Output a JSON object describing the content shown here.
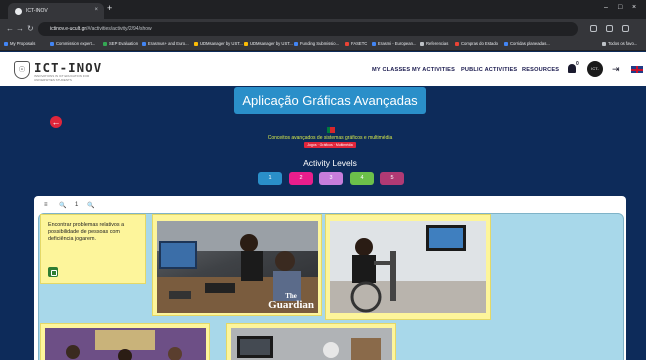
{
  "browser": {
    "tab_title": "ICT-INOV",
    "new_tab": "+",
    "window_controls": [
      "–",
      "□",
      "×"
    ],
    "nav": [
      "←",
      "→",
      "↻"
    ],
    "url_host": "ictinov.e-ucult.gr",
    "url_path": "/#/activities/activity/2/94/show",
    "bookmarks": [
      "My Proposals",
      "Commission expert...",
      "SEP Evaluation",
      "Erasmus+ and Euro...",
      "UDMsanager by UST...",
      "UDMsanager by UST...",
      "Funding Submissio...",
      "FASETC",
      "Erasmi - European...",
      "Referencias",
      "Compras do Estado",
      "Corridas planeadas..."
    ],
    "all_bookmarks": "Todos os favo..."
  },
  "site": {
    "logo_text": "ICT-INOV",
    "logo_sub": "INNOVATIONS IN ICT EDUCATION FOR UNIVERSITIES STUDENTS",
    "nav": {
      "classes": "MY CLASSES",
      "activities": "MY ACTIVITIES",
      "public": "PUBLIC ACTIVITIES",
      "resources": "RESOURCES"
    },
    "notifications": "0",
    "avatar_label": "ICT-INOV",
    "logout_icon": "⇥"
  },
  "page": {
    "title": "Aplicação Gráficas Avançadas",
    "back_icon": "←",
    "subtitle": "Conceitos avançados de sistemas gráficos e multimédia",
    "tags": "Jogos · Gráficos · Multimédia",
    "activity_levels_title": "Activity Levels",
    "levels": [
      {
        "label": "1",
        "color": "#2a8fc9"
      },
      {
        "label": "2",
        "color": "#e91e8c"
      },
      {
        "label": "3",
        "color": "#c77ddb"
      },
      {
        "label": "4",
        "color": "#6cc04a"
      },
      {
        "label": "5",
        "color": "#b03a74"
      }
    ]
  },
  "board": {
    "toolbar": [
      "≡",
      "🔍",
      "1",
      "🔍"
    ],
    "card_text": "Encontrar problemas relativos a possibilidade de pessoas com deficiência jogarem.",
    "watermark": {
      "line1": "The",
      "line2": "Guardian"
    }
  },
  "colors": {
    "background": "#0d2b5a",
    "accent": "#2a8fc9",
    "sticky": "#fdf59b",
    "board": "#a8d8ea"
  }
}
